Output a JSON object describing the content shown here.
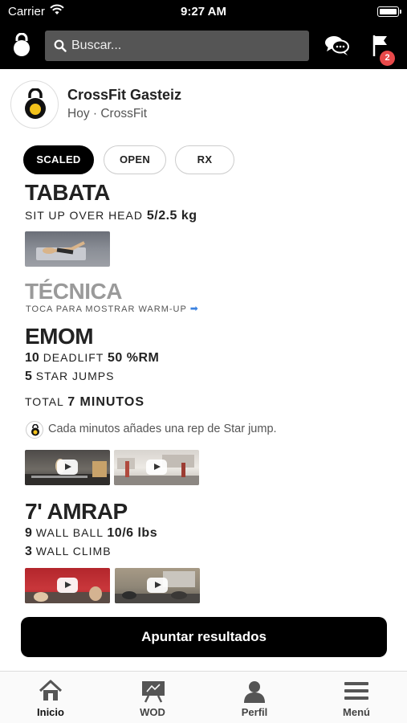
{
  "status_bar": {
    "carrier": "Carrier",
    "time": "9:27 AM"
  },
  "navbar": {
    "search_placeholder": "Buscar...",
    "notifications_badge": "2",
    "icons": [
      "kettlebell-logo-icon",
      "search-icon",
      "chat-icon",
      "flag-icon"
    ]
  },
  "header": {
    "box_name": "CrossFit Gasteiz",
    "subtitle": "Hoy · CrossFit"
  },
  "levels": [
    {
      "label": "SCALED",
      "active": true
    },
    {
      "label": "OPEN",
      "active": false
    },
    {
      "label": "RX",
      "active": false
    }
  ],
  "tabata": {
    "title": "TABATA",
    "exercise": "SIT UP OVER HEAD",
    "weight": "5/2.5 kg"
  },
  "tecnica": {
    "title": "TÉCNICA",
    "subtitle": "TOCA PARA MOSTRAR WARM-UP",
    "arrow": "➡"
  },
  "emom": {
    "title": "EMOM",
    "items": [
      {
        "reps": "10",
        "name": "DEADLIFT",
        "load": "50 %RM"
      },
      {
        "reps": "5",
        "name": "STAR JUMPS",
        "load": ""
      }
    ],
    "total_label": "TOTAL",
    "total_value": "7 MINUTOS",
    "note": "Cada minutos añades una rep de Star jump."
  },
  "amrap": {
    "title": "7' AMRAP",
    "items": [
      {
        "reps": "9",
        "name": "WALL BALL",
        "load": "10/6 lbs"
      },
      {
        "reps": "3",
        "name": "WALL CLIMB",
        "load": ""
      }
    ]
  },
  "cta_label": "Apuntar resultados",
  "tabbar": [
    {
      "label": "Inicio",
      "icon": "home-icon",
      "active": true
    },
    {
      "label": "WOD",
      "icon": "whiteboard-icon",
      "active": false
    },
    {
      "label": "Perfil",
      "icon": "person-icon",
      "active": false
    },
    {
      "label": "Menú",
      "icon": "hamburger-icon",
      "active": false
    }
  ],
  "colors": {
    "accent": "#000000",
    "badge": "#e8494a",
    "link_arrow": "#3b82e0"
  }
}
